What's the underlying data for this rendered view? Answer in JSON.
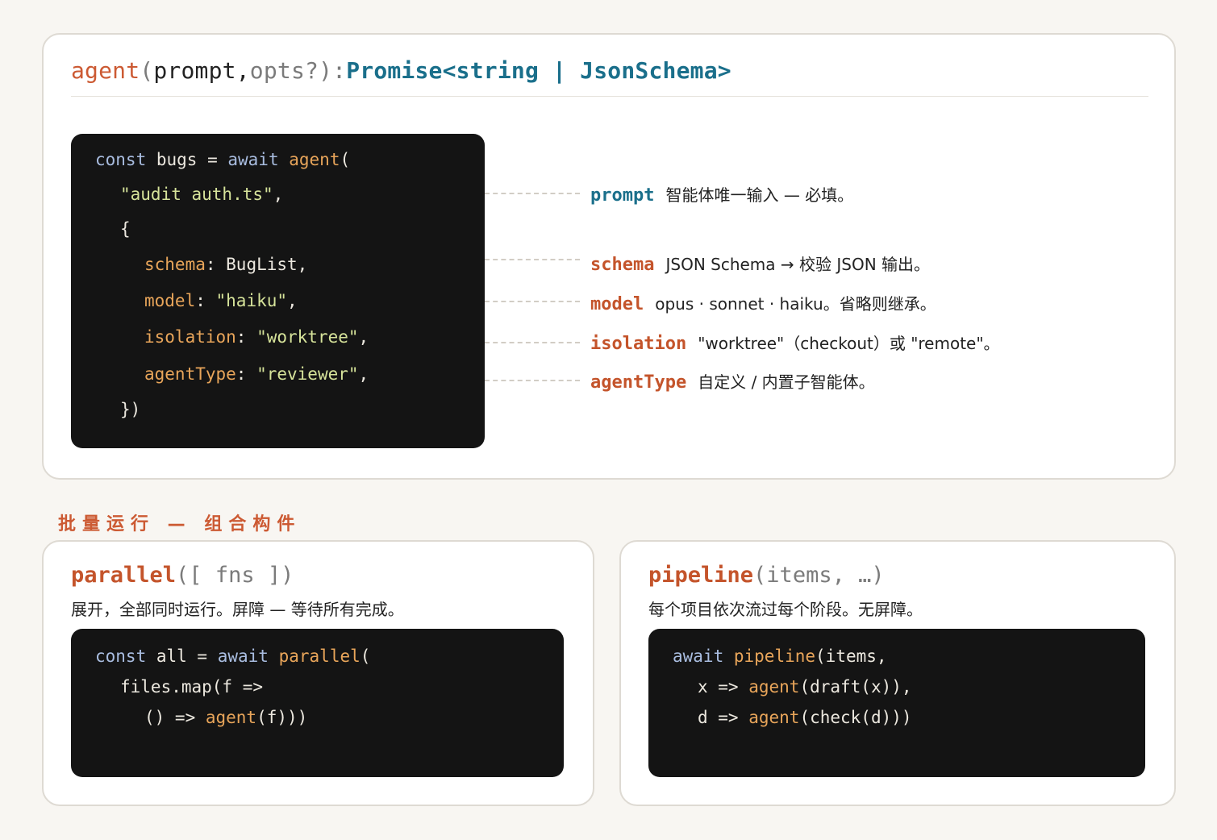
{
  "signature": {
    "fn": "agent",
    "open_paren": "(",
    "param1": "prompt",
    "comma": ",",
    "param2": "opts?",
    "close": "):",
    "return_type": "Promise<string | JsonSchema>"
  },
  "main_code": {
    "line1": {
      "kw1": "const",
      "plain1": " bugs = ",
      "kw2": "await",
      "sp": " ",
      "fn": "agent",
      "tail": "("
    },
    "line2": {
      "str": "\"audit auth.ts\"",
      "tail": ","
    },
    "line3": {
      "text": "{"
    },
    "line4": {
      "prop": "schema",
      "colon": ": ",
      "val": "BugList",
      "tail": ","
    },
    "line5": {
      "prop": "model",
      "colon": ": ",
      "str": "\"haiku\"",
      "tail": ","
    },
    "line6": {
      "prop": "isolation",
      "colon": ": ",
      "str": "\"worktree\"",
      "tail": ","
    },
    "line7": {
      "prop": "agentType",
      "colon": ": ",
      "str": "\"reviewer\"",
      "tail": ","
    },
    "line8": {
      "text": "})"
    }
  },
  "annotations": [
    {
      "key": "prompt",
      "desc": "智能体唯一输入 — 必填。"
    },
    {
      "key": "schema",
      "desc": "JSON Schema → 校验 JSON 输出。"
    },
    {
      "key": "model",
      "desc": "opus · sonnet · haiku。省略则继承。"
    },
    {
      "key": "isolation",
      "desc": "\"worktree\"（checkout）或 \"remote\"。"
    },
    {
      "key": "agentType",
      "desc": "自定义 / 内置子智能体。"
    }
  ],
  "section_label": "批量运行 — 组合构件",
  "parallel": {
    "title_fn": "parallel",
    "title_args": "([ fns ])",
    "desc": "展开，全部同时运行。屏障 — 等待所有完成。",
    "code": {
      "line1": {
        "kw1": "const",
        "plain1": " all = ",
        "kw2": "await",
        "sp": " ",
        "fn": "parallel",
        "tail": "("
      },
      "line2": {
        "text": "files.map(f =>"
      },
      "line3": {
        "pre": "() => ",
        "fn": "agent",
        "tail": "(f)))"
      }
    }
  },
  "pipeline": {
    "title_fn": "pipeline",
    "title_args": "(items, …)",
    "desc": "每个项目依次流过每个阶段。无屏障。",
    "code": {
      "line1": {
        "kw": "await",
        "sp": " ",
        "fn": "pipeline",
        "tail": "(items,"
      },
      "line2": {
        "pre": "x => ",
        "fn": "agent",
        "tail": "(draft(x)),"
      },
      "line3": {
        "pre": "d => ",
        "fn": "agent",
        "tail": "(check(d)))"
      }
    }
  },
  "colors": {
    "accent_orange": "#cc5a33",
    "type_teal": "#1a6f8b",
    "code_bg": "#141414",
    "page_bg": "#f8f6f2"
  }
}
